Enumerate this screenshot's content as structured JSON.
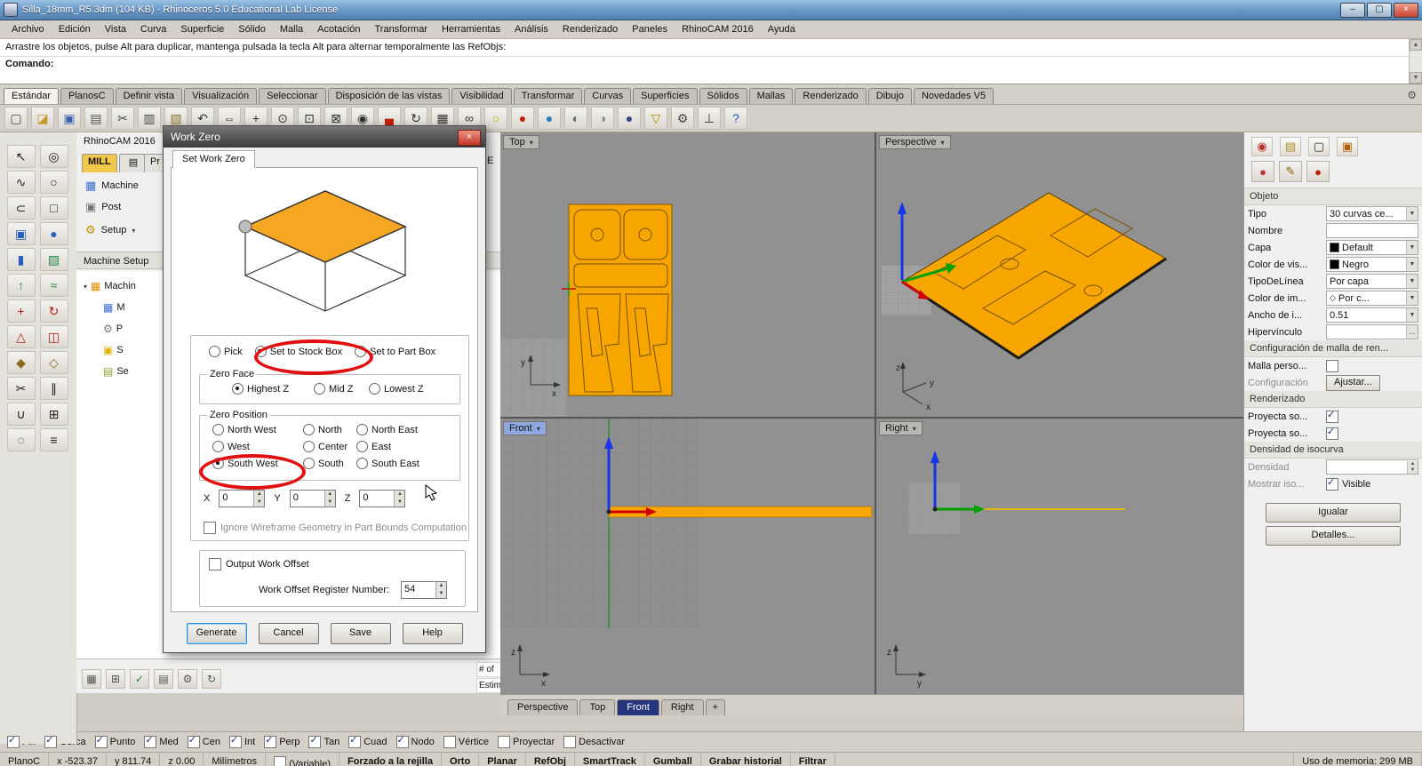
{
  "colors": {
    "accent_orange": "#F7A600",
    "annotation_red": "#E01010",
    "axis_blue": "#1535E8",
    "axis_green": "#00A000",
    "axis_red": "#D00000",
    "mill_tab_yellow": "#F2C84B"
  },
  "titlebar": {
    "title": "Silla_18mm_R5.3dm (104 KB) - Rhinoceros 5.0 Educational Lab License",
    "minimize_glyph": "–",
    "maximize_glyph": "▢",
    "close_glyph": "×"
  },
  "menubar": {
    "items": [
      {
        "n": "menu-archivo",
        "label": "Archivo"
      },
      {
        "n": "menu-edicion",
        "label": "Edición"
      },
      {
        "n": "menu-vista",
        "label": "Vista"
      },
      {
        "n": "menu-curva",
        "label": "Curva"
      },
      {
        "n": "menu-superficie",
        "label": "Superficie"
      },
      {
        "n": "menu-solido",
        "label": "Sólido"
      },
      {
        "n": "menu-malla",
        "label": "Malla"
      },
      {
        "n": "menu-acotacion",
        "label": "Acotación"
      },
      {
        "n": "menu-transformar",
        "label": "Transformar"
      },
      {
        "n": "menu-herramientas",
        "label": "Herramientas"
      },
      {
        "n": "menu-analisis",
        "label": "Análisis"
      },
      {
        "n": "menu-renderizado",
        "label": "Renderizado"
      },
      {
        "n": "menu-paneles",
        "label": "Paneles"
      },
      {
        "n": "menu-rhinocam-2016",
        "label": "RhinoCAM 2016"
      },
      {
        "n": "menu-ayuda",
        "label": "Ayuda"
      }
    ]
  },
  "command": {
    "history": "Arrastre los objetos, pulse Alt para duplicar, mantenga pulsada la tecla Alt para alternar temporalmente las RefObjs:",
    "prompt": "Comando:",
    "scroll_up": "▲",
    "scroll_down": "▼"
  },
  "tabbar": {
    "gear_glyph": "⚙",
    "tabs": [
      {
        "n": "tab-estandar",
        "label": "Estándar",
        "active": true
      },
      {
        "n": "tab-planosc",
        "label": "PlanosC",
        "active": false
      },
      {
        "n": "tab-definir-vista",
        "label": "Definir vista",
        "active": false
      },
      {
        "n": "tab-visualizacion",
        "label": "Visualización",
        "active": false
      },
      {
        "n": "tab-seleccionar",
        "label": "Seleccionar",
        "active": false
      },
      {
        "n": "tab-disposicion-de-las-vistas",
        "label": "Disposición de las vistas",
        "active": false
      },
      {
        "n": "tab-visibilidad",
        "label": "Visibilidad",
        "active": false
      },
      {
        "n": "tab-transformar",
        "label": "Transformar",
        "active": false
      },
      {
        "n": "tab-curvas",
        "label": "Curvas",
        "active": false
      },
      {
        "n": "tab-superficies",
        "label": "Superficies",
        "active": false
      },
      {
        "n": "tab-solidos",
        "label": "Sólidos",
        "active": false
      },
      {
        "n": "tab-mallas",
        "label": "Mallas",
        "active": false
      },
      {
        "n": "tab-renderizado",
        "label": "Renderizado",
        "active": false
      },
      {
        "n": "tab-dibujo",
        "label": "Dibujo",
        "active": false
      },
      {
        "n": "tab-novedades-v5",
        "label": "Novedades V5",
        "active": false
      }
    ]
  },
  "toolbar": {
    "icons": [
      {
        "n": "new-document-icon",
        "g": "▢",
        "c": "#444444"
      },
      {
        "n": "open-file-icon",
        "g": "◪",
        "c": "#c89a30"
      },
      {
        "n": "save-icon",
        "g": "▣",
        "c": "#3a5fae"
      },
      {
        "n": "print-icon",
        "g": "▤",
        "c": "#555555"
      },
      {
        "n": "cut-icon",
        "g": "✂",
        "c": "#444444"
      },
      {
        "n": "copy-icon",
        "g": "▥",
        "c": "#444444"
      },
      {
        "n": "paste-icon",
        "g": "▧",
        "c": "#8a7a30"
      },
      {
        "n": "undo-icon",
        "g": "↶",
        "c": "#333333"
      },
      {
        "n": "pan-icon",
        "g": "⇔",
        "c": "#333333"
      },
      {
        "n": "move-icon",
        "g": "+",
        "c": "#333333"
      },
      {
        "n": "zoom-dynamic-icon",
        "g": "⊙",
        "c": "#333333"
      },
      {
        "n": "zoom-window-icon",
        "g": "⊡",
        "c": "#333333"
      },
      {
        "n": "zoom-extents-icon",
        "g": "⊠",
        "c": "#333333"
      },
      {
        "n": "zoom-selected-icon",
        "g": "◉",
        "c": "#333333"
      },
      {
        "n": "car-icon",
        "g": "▄",
        "c": "#c22000"
      },
      {
        "n": "rotate-view-icon",
        "g": "↻",
        "c": "#333333"
      },
      {
        "n": "named-view-icon",
        "g": "▦",
        "c": "#333333"
      },
      {
        "n": "link-icon",
        "g": "∞",
        "c": "#333333"
      },
      {
        "n": "light-icon",
        "g": "○",
        "c": "#caa500"
      },
      {
        "n": "render-sphere-icon",
        "g": "●",
        "c": "#c22000"
      },
      {
        "n": "rgb-sphere-icon",
        "g": "●",
        "c": "#2a7ac0"
      },
      {
        "n": "shaded-view-icon",
        "g": "◐",
        "c": "#666666"
      },
      {
        "n": "ghosted-view-icon",
        "g": "◑",
        "c": "#888888"
      },
      {
        "n": "rendered-view-icon",
        "g": "●",
        "c": "#39478f"
      },
      {
        "n": "filter-icon",
        "g": "▽",
        "c": "#b09000"
      },
      {
        "n": "options-gear-icon",
        "g": "⚙",
        "c": "#444444"
      },
      {
        "n": "cplane-icon",
        "g": "⊥",
        "c": "#333333"
      },
      {
        "n": "help-icon",
        "g": "?",
        "c": "#1f5fd0"
      }
    ]
  },
  "palette": {
    "icons": [
      {
        "n": "select-arrow-icon",
        "g": "↖",
        "c": "#222222"
      },
      {
        "n": "selection-filter-icon",
        "g": "◎",
        "c": "#222222"
      },
      {
        "n": "polyline-icon",
        "g": "∿",
        "c": "#222222"
      },
      {
        "n": "circle-icon",
        "g": "○",
        "c": "#222222"
      },
      {
        "n": "arc-icon",
        "g": "⊂",
        "c": "#222222"
      },
      {
        "n": "rectangle-icon",
        "g": "□",
        "c": "#222222"
      },
      {
        "n": "box-icon",
        "g": "▣",
        "c": "#2a5fc0"
      },
      {
        "n": "sphere-icon",
        "g": "●",
        "c": "#2a5fc0"
      },
      {
        "n": "cylinder-icon",
        "g": "▮",
        "c": "#2a5fc0"
      },
      {
        "n": "surface-icon",
        "g": "▨",
        "c": "#2a8a4a"
      },
      {
        "n": "extrude-icon",
        "g": "↑",
        "c": "#2a8a4a"
      },
      {
        "n": "loft-icon",
        "g": "≈",
        "c": "#2a8a4a"
      },
      {
        "n": "move-tool-icon",
        "g": "+",
        "c": "#b02020"
      },
      {
        "n": "rotate-tool-icon",
        "g": "↻",
        "c": "#b02020"
      },
      {
        "n": "scale-tool-icon",
        "g": "△",
        "c": "#b02020"
      },
      {
        "n": "mirror-tool-icon",
        "g": "◫",
        "c": "#b02020"
      },
      {
        "n": "fillet-icon",
        "g": "◆",
        "c": "#8a6a20"
      },
      {
        "n": "chamfer-icon",
        "g": "◇",
        "c": "#8a6a20"
      },
      {
        "n": "trim-icon",
        "g": "✂",
        "c": "#222222"
      },
      {
        "n": "split-icon",
        "g": "∥",
        "c": "#222222"
      },
      {
        "n": "join-icon",
        "g": "∪",
        "c": "#222222"
      },
      {
        "n": "group-icon",
        "g": "⊞",
        "c": "#222222"
      },
      {
        "n": "hide-icon",
        "g": "◌",
        "c": "#222222"
      },
      {
        "n": "layers-icon",
        "g": "≡",
        "c": "#222222"
      }
    ]
  },
  "rhinocam": {
    "title": "RhinoCAM 2016",
    "mill_tab": "MILL",
    "icon_tab_glyph": "▤",
    "program_tab_fragment": "Pr",
    "menu_rows": [
      {
        "n": "rhinocam-machine",
        "label": "Machine",
        "g": "▦",
        "c": "#3b6fd4"
      },
      {
        "n": "rhinocam-post",
        "label": "Post",
        "g": "▣",
        "c": "#777777"
      },
      {
        "n": "rhinocam-setup",
        "label": "Setup",
        "g": "⚙",
        "c": "#c09000"
      }
    ],
    "setup_dd": "▾",
    "section_header": "Machine Setup",
    "tree": [
      {
        "n": "tree-machining-job",
        "label": "Machin",
        "g": "▦",
        "c": "#e09000"
      },
      {
        "n": "tree-machine",
        "label": "M",
        "g": "▦",
        "c": "#3b6fd4"
      },
      {
        "n": "tree-post",
        "label": "P",
        "g": "⚙",
        "c": "#777777"
      },
      {
        "n": "tree-stock",
        "label": "S",
        "g": "▣",
        "c": "#e0b000"
      },
      {
        "n": "tree-setup",
        "label": "Se",
        "g": "▤",
        "c": "#8aa030"
      }
    ],
    "expander": "▾",
    "bottom_icons": [
      {
        "n": "machining-browser-icon",
        "g": "▦",
        "c": "#555555"
      },
      {
        "n": "toolpath-editor-icon",
        "g": "⊞",
        "c": "#555555"
      },
      {
        "n": "simulate-icon",
        "g": "✓",
        "c": "#2a8a2a"
      },
      {
        "n": "post-all-icon",
        "g": "▤",
        "c": "#555555"
      },
      {
        "n": "cam-options-icon",
        "g": "⚙",
        "c": "#555555"
      },
      {
        "n": "regenerate-icon",
        "g": "↻",
        "c": "#555555"
      }
    ],
    "fragments": {
      "top": "E",
      "row1": "# of GO",
      "row2": "Estimat"
    }
  },
  "dialog": {
    "title": "Work Zero",
    "close_glyph": "×",
    "tab_label": "Set Work Zero",
    "mode": [
      {
        "n": "mode-pick",
        "label": "Pick",
        "sel": false
      },
      {
        "n": "mode-set-to-stock-box",
        "label": "Set to Stock Box",
        "sel": true
      },
      {
        "n": "mode-set-to-part-box",
        "label": "Set to Part Box",
        "sel": false
      }
    ],
    "zero_face_label": "Zero Face",
    "zero_face": [
      {
        "n": "zf-highest-z",
        "label": "Highest Z",
        "sel": true
      },
      {
        "n": "zf-mid-z",
        "label": "Mid Z",
        "sel": false
      },
      {
        "n": "zf-lowest-z",
        "label": "Lowest Z",
        "sel": false
      }
    ],
    "zero_position_label": "Zero Position",
    "zero_position": [
      {
        "n": "zp-north-west",
        "label": "North West",
        "sel": false
      },
      {
        "n": "zp-north",
        "label": "North",
        "sel": false
      },
      {
        "n": "zp-north-east",
        "label": "North East",
        "sel": false
      },
      {
        "n": "zp-west",
        "label": "West",
        "sel": false
      },
      {
        "n": "zp-center",
        "label": "Center",
        "sel": false
      },
      {
        "n": "zp-east",
        "label": "East",
        "sel": false
      },
      {
        "n": "zp-south-west",
        "label": "South West",
        "sel": true
      },
      {
        "n": "zp-south",
        "label": "South",
        "sel": false
      },
      {
        "n": "zp-south-east",
        "label": "South East",
        "sel": false
      }
    ],
    "coords": {
      "x_label": "X",
      "x": "0",
      "y_label": "Y",
      "y": "0",
      "z_label": "Z",
      "z": "0"
    },
    "spin_up": "▲",
    "spin_down": "▼",
    "ignore_label": "Ignore Wireframe Geometry in Part Bounds Computation",
    "output_label": "Output Work Offset",
    "register_label": "Work Offset Register Number:",
    "register_value": "54",
    "buttons": [
      {
        "n": "generate-button",
        "label": "Generate"
      },
      {
        "n": "cancel-button",
        "label": "Cancel"
      },
      {
        "n": "save-button",
        "label": "Save"
      },
      {
        "n": "help-button",
        "label": "Help"
      }
    ]
  },
  "viewports": {
    "top_label": "Top",
    "perspective_label": "Perspective",
    "front_label": "Front",
    "right_label": "Right",
    "dropdown_glyph": "▾",
    "axis_x": "x",
    "axis_y": "y",
    "axis_z": "z"
  },
  "viewport_tabs": {
    "add_label": "+",
    "tabs": [
      {
        "n": "vptab-perspective",
        "label": "Perspective",
        "active": false
      },
      {
        "n": "vptab-top",
        "label": "Top",
        "active": false
      },
      {
        "n": "vptab-front",
        "label": "Front",
        "active": true
      },
      {
        "n": "vptab-right",
        "label": "Right",
        "active": false
      }
    ]
  },
  "props": {
    "tab_icons": [
      {
        "n": "properties-tab-icon",
        "g": "◉",
        "c": "#c03030"
      },
      {
        "n": "material-tab-icon",
        "g": "▤",
        "c": "#b08a20"
      },
      {
        "n": "display-tab-icon",
        "g": "▢",
        "c": "#333333"
      },
      {
        "n": "camera-tab-icon",
        "g": "▣",
        "c": "#b06000"
      }
    ],
    "object_icons": [
      {
        "n": "object-properties-icon",
        "g": "●",
        "c": "#c03030"
      },
      {
        "n": "pencil-icon",
        "g": "✎",
        "c": "#7a6000"
      },
      {
        "n": "material-ball-icon",
        "g": "●",
        "c": "#c02000"
      }
    ],
    "objeto_header": "Objeto",
    "rows": [
      {
        "label": "Tipo",
        "value": "30 curvas ce..."
      },
      {
        "label": "Nombre",
        "value": ""
      },
      {
        "label": "Capa",
        "value": "Default"
      },
      {
        "label": "Color de vis...",
        "value": "Negro"
      },
      {
        "label": "TipoDeLínea",
        "value": "Por capa"
      },
      {
        "label": "Color de im...",
        "value": "Por c..."
      },
      {
        "label": "Ancho de i...",
        "value": "0.51"
      },
      {
        "label": "Hipervínculo",
        "value": ""
      }
    ],
    "diamond_glyph": "◇",
    "ellipsis_label": "...",
    "dd_glyph": "▼",
    "mesh_header": "Configuración de malla de ren...",
    "mesh_row1_label": "Malla perso...",
    "mesh_row2_label": "Configuración",
    "mesh_row2_button": "Ajustar...",
    "render_header": "Renderizado",
    "render_row1_label": "Proyecta so...",
    "render_row2_label": "Proyecta so...",
    "iso_header": "Densidad de isocurva",
    "iso_row1_label": "Densidad",
    "iso_row2_label": "Mostrar iso...",
    "iso_row2_value": "Visible",
    "igualar_button": "Igualar",
    "detalles_button": "Detalles..."
  },
  "osnap": {
    "items": [
      {
        "n": "osnap-fin",
        "label": "Fin",
        "on": true
      },
      {
        "n": "osnap-cerca",
        "label": "Cerca",
        "on": true
      },
      {
        "n": "osnap-punto",
        "label": "Punto",
        "on": true
      },
      {
        "n": "osnap-med",
        "label": "Med",
        "on": true
      },
      {
        "n": "osnap-cen",
        "label": "Cen",
        "on": true
      },
      {
        "n": "osnap-int",
        "label": "Int",
        "on": true
      },
      {
        "n": "osnap-perp",
        "label": "Perp",
        "on": true
      },
      {
        "n": "osnap-tan",
        "label": "Tan",
        "on": true
      },
      {
        "n": "osnap-cuad",
        "label": "Cuad",
        "on": true
      },
      {
        "n": "osnap-nodo",
        "label": "Nodo",
        "on": true
      },
      {
        "n": "osnap-vertice",
        "label": "Vértice",
        "on": false
      },
      {
        "n": "osnap-proyectar",
        "label": "Proyectar",
        "on": false
      },
      {
        "n": "osnap-desactivar",
        "label": "Desactivar",
        "on": false
      }
    ]
  },
  "statusbar": {
    "cplane": "PlanoC",
    "x": "x -523.37",
    "y": "y 811.74",
    "z": "z 0.00",
    "units": "Milímetros",
    "layer_toggle": "(Variable)",
    "toggles": [
      {
        "n": "status-forzado-rejilla",
        "label": "Forzado a la rejilla"
      },
      {
        "n": "status-orto",
        "label": "Orto"
      },
      {
        "n": "status-planar",
        "label": "Planar"
      },
      {
        "n": "status-refobj",
        "label": "RefObj"
      },
      {
        "n": "status-smarttrack",
        "label": "SmartTrack"
      },
      {
        "n": "status-gumball",
        "label": "Gumball"
      },
      {
        "n": "status-grabar-historial",
        "label": "Grabar historial"
      },
      {
        "n": "status-filtrar",
        "label": "Filtrar"
      }
    ],
    "memory": "Uso de memoria: 299 MB"
  }
}
